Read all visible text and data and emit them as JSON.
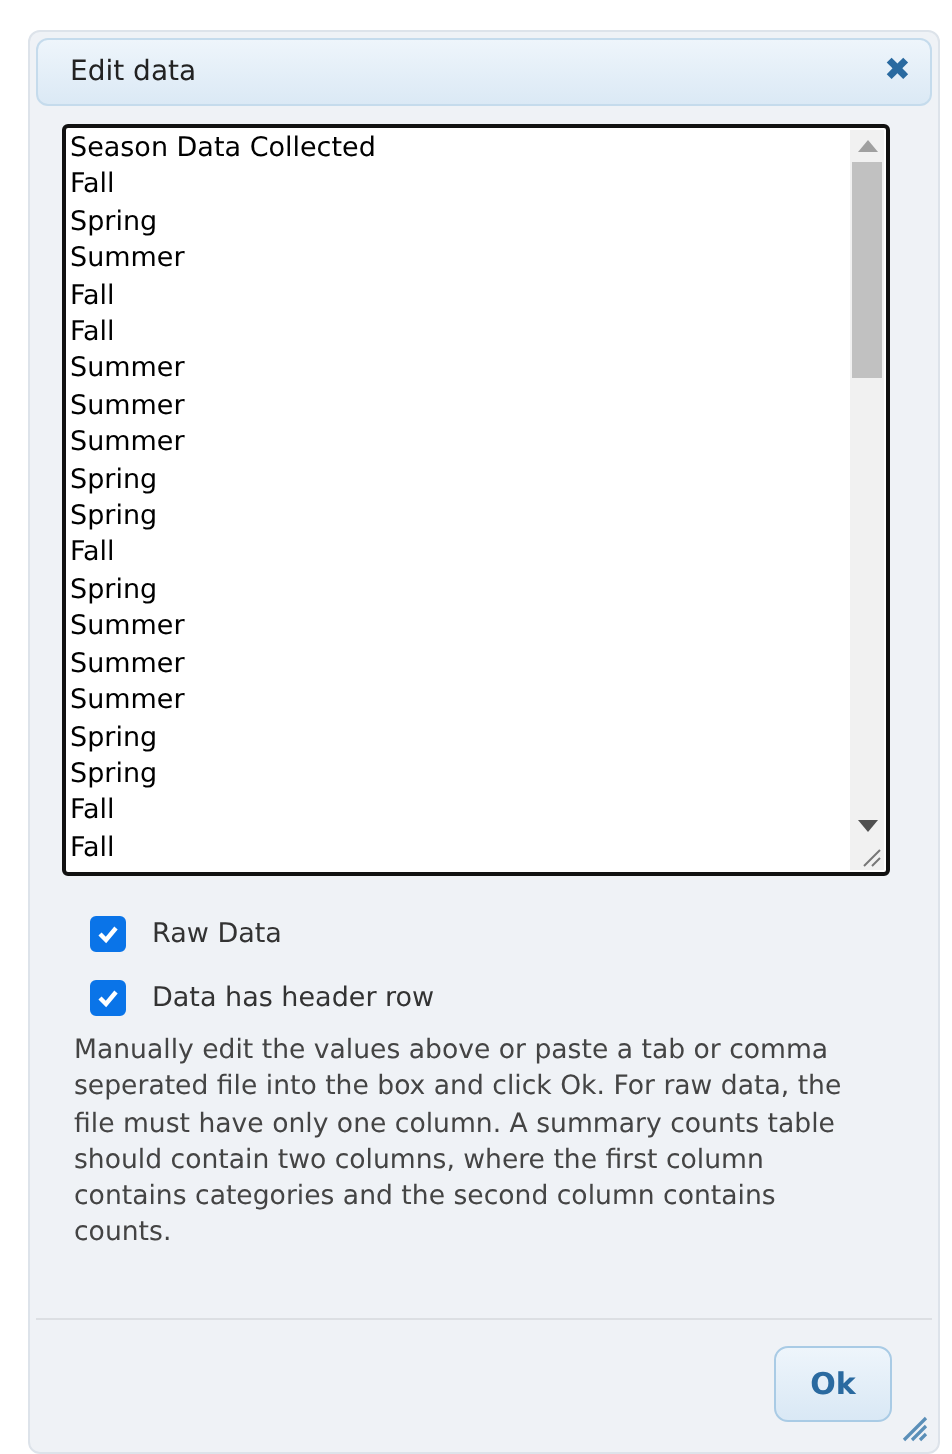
{
  "dialog": {
    "title": "Edit data",
    "close": "✖"
  },
  "data_text": [
    "Season Data Collected",
    "Fall",
    "Spring",
    "Summer",
    "Fall",
    "Fall",
    "Summer",
    "Summer",
    "Summer",
    "Spring",
    "Spring",
    "Fall",
    "Spring",
    "Summer",
    "Summer",
    "Summer",
    "Spring",
    "Spring",
    "Fall",
    "Fall"
  ],
  "options": [
    {
      "label": "Raw Data",
      "checked": true
    },
    {
      "label": "Data has header row",
      "checked": true
    }
  ],
  "help_text": "Manually edit the values above or paste a tab or comma seperated file into the box and click Ok. For raw data, the file must have only one column. A summary counts table should contain two columns, where the first column contains categories and the second column contains counts.",
  "buttons": [
    "Ok"
  ]
}
